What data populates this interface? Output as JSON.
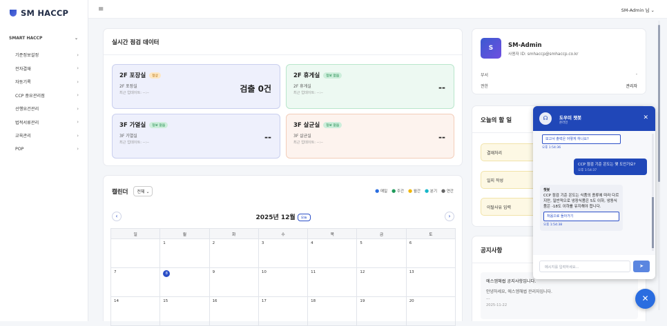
{
  "sidebar": {
    "logo": "SM HACCP",
    "section": "SMART HACCP",
    "items": [
      {
        "label": "기준정보설정"
      },
      {
        "label": "전자결재"
      },
      {
        "label": "자동기록"
      },
      {
        "label": "CCP 중요관리점"
      },
      {
        "label": "선행요건관리"
      },
      {
        "label": "법적서류관리"
      },
      {
        "label": "교육관리"
      },
      {
        "label": "POP"
      }
    ],
    "chevron": "›",
    "section_chevron": "⌄"
  },
  "topbar": {
    "menu_icon": "≡",
    "user": "SM-Admin 님 ⌄"
  },
  "realtime": {
    "title": "실시간 점검 데이터",
    "cards": [
      {
        "name": "2F 포장실",
        "badge": "정상",
        "sub": "2F 포장실",
        "updated": "최근 업데이트: --:--",
        "value": "검출 0건"
      },
      {
        "name": "2F 휴게실",
        "badge": "정보 없음",
        "sub": "2F 휴게실",
        "updated": "최근 업데이트: --:--",
        "value": "--"
      },
      {
        "name": "3F 가열실",
        "badge": "정보 없음",
        "sub": "3F 가열실",
        "updated": "최근 업데이트: --:--",
        "value": "--"
      },
      {
        "name": "3F 살균실",
        "badge": "정보 없음",
        "sub": "3F 살균실",
        "updated": "최근 업데이트: --:--",
        "value": "--"
      }
    ]
  },
  "calendar": {
    "title": "캘린더",
    "filter": "전체",
    "legend": [
      {
        "label": "매일",
        "color": "#2a6de0"
      },
      {
        "label": "주간",
        "color": "#1f9a5a"
      },
      {
        "label": "월간",
        "color": "#f2b705"
      },
      {
        "label": "분기",
        "color": "#18b7c9"
      },
      {
        "label": "연간",
        "color": "#666666"
      }
    ],
    "month": "2025년 12월",
    "today_label": "오늘",
    "prev": "‹",
    "next": "›",
    "weekdays": [
      "일",
      "월",
      "화",
      "수",
      "목",
      "금",
      "토"
    ],
    "weeks": [
      [
        "",
        "1",
        "2",
        "3",
        "4",
        "5",
        "6"
      ],
      [
        "7",
        "8",
        "9",
        "10",
        "11",
        "12",
        "13"
      ],
      [
        "14",
        "15",
        "16",
        "17",
        "18",
        "19",
        "20"
      ]
    ],
    "today": "8"
  },
  "profile": {
    "initial": "S",
    "name": "SM-Admin",
    "user_id": "사용자 ID: smhaccp@smhaccp.co.kr",
    "dept_label": "부서",
    "dept_value": "-",
    "role_label": "권한",
    "role_value": "관리자"
  },
  "todo": {
    "title": "오늘의 할 일",
    "items": [
      "결재처리",
      "일지 작성",
      "이탈사유 입력"
    ]
  },
  "notice": {
    "title": "공지사항",
    "item_title": "에스엠해썹 공지사항입니다.",
    "item_body": "안녕하세요, 에스엠해썹 관리자입니다.",
    "item_more": "...",
    "item_date": "2025-11-22"
  },
  "chat": {
    "title": "도우미 챗봇",
    "subtitle": "온라인",
    "close": "✕",
    "q_prev": "보고서 출력은 어떻게 하나요?",
    "q_prev_time": "오후 1:54:36",
    "user_msg": "CCP 점검 기준 온도는 몇 도인가요?",
    "user_time": "오후 1:54:37",
    "bot_name": "챗봇",
    "bot_msg": "CCP 점검 기준 온도는 식품의 종류에 따라 다르지만, 일반적으로 냉장식품은 5도 이하, 냉동식품은 -18도 이하를 유지해야 합니다.",
    "back_btn": "처음으로 돌아가기",
    "bot_time": "오후 1:54:38",
    "input_placeholder": "메시지를 입력하세요...",
    "send_icon": "➤",
    "fab_icon": "✕"
  }
}
